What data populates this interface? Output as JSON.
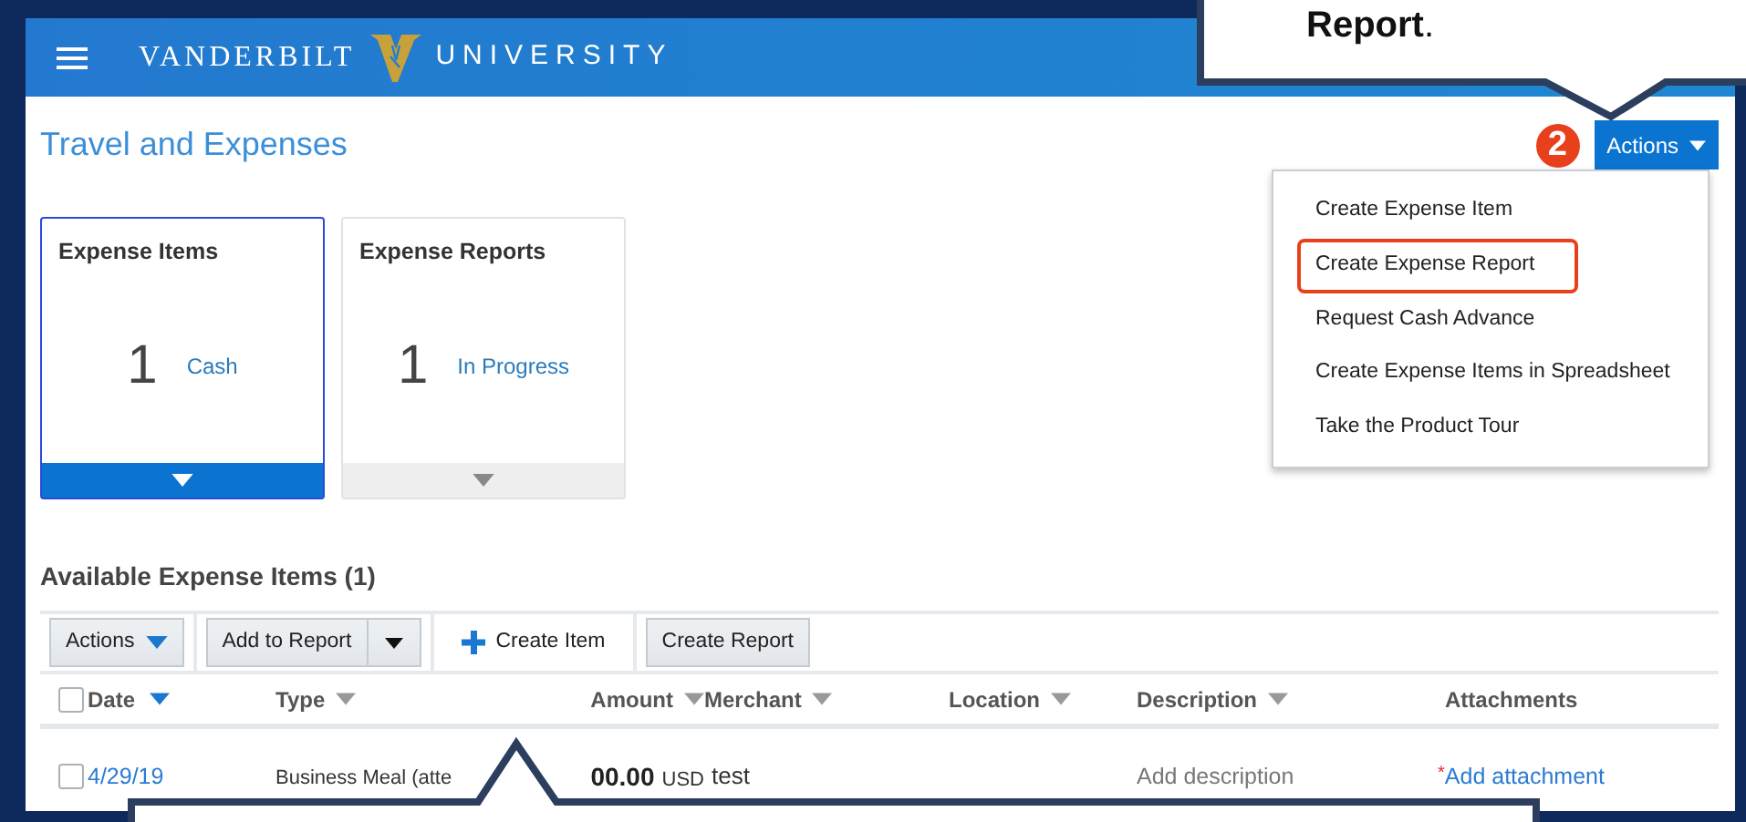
{
  "header": {
    "logo_left": "VANDERBILT",
    "logo_right": "UNIVERSITY"
  },
  "page_title": "Travel and Expenses",
  "step_badge": "2",
  "actions_button": {
    "label": "Actions",
    "expanded": true
  },
  "actions_menu": [
    {
      "label": "Create Expense Item",
      "highlighted": false
    },
    {
      "label": "Create Expense Report",
      "highlighted": true
    },
    {
      "label": "Request Cash Advance",
      "highlighted": false
    },
    {
      "label": "Create Expense Items in Spreadsheet",
      "highlighted": false
    },
    {
      "label": "Take the Product Tour",
      "highlighted": false
    }
  ],
  "cards": [
    {
      "title": "Expense Items",
      "count": "1",
      "status": "Cash",
      "selected": true
    },
    {
      "title": "Expense Reports",
      "count": "1",
      "status": "In Progress",
      "selected": false
    }
  ],
  "section_title": "Available Expense Items (1)",
  "toolbar": [
    {
      "kind": "dropdown",
      "label": "Actions"
    },
    {
      "kind": "split",
      "label": "Add to Report"
    },
    {
      "kind": "create",
      "label": "Create Item"
    },
    {
      "kind": "button",
      "label": "Create Report"
    }
  ],
  "table": {
    "select_all_checked": false,
    "columns": [
      {
        "label": "Date",
        "sortable": true,
        "sorted": true
      },
      {
        "label": "Type",
        "sortable": true,
        "sorted": false
      },
      {
        "label": "Amount",
        "sortable": true,
        "sorted": false
      },
      {
        "label": "Merchant",
        "sortable": true,
        "sorted": false
      },
      {
        "label": "Location",
        "sortable": true,
        "sorted": false
      },
      {
        "label": "Description",
        "sortable": true,
        "sorted": false
      },
      {
        "label": "Attachments",
        "sortable": false
      }
    ],
    "rows": [
      {
        "checked": false,
        "date": "4/29/19",
        "type": "Business Meal (atte",
        "amount": "00.00",
        "currency": "USD",
        "merchant": "test",
        "description_placeholder": "Add description",
        "required_mark": "*",
        "attachment": "Add attachment"
      }
    ]
  },
  "callout_text": "**Report**."
}
